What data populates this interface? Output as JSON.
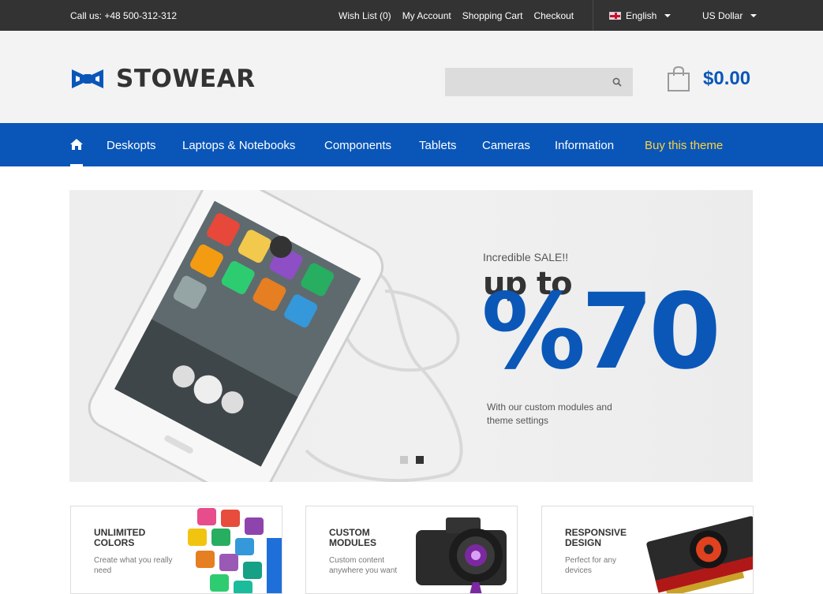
{
  "topbar": {
    "phone": "Call us: +48 500-312-312",
    "links": [
      "Wish List (0)",
      "My Account",
      "Shopping Cart",
      "Checkout"
    ],
    "language": "English",
    "currency": "US Dollar"
  },
  "header": {
    "logo_text": "STOWEAR",
    "search_placeholder": "",
    "cart_total": "$0.00"
  },
  "nav": {
    "items": [
      "Deskopts",
      "Laptops & Notebooks",
      "Components",
      "Tablets",
      "Cameras",
      "Information"
    ],
    "highlight": "Buy this theme"
  },
  "slider": {
    "kicker": "Incredible SALE!!",
    "headline": "up to",
    "big": "%70",
    "description": "With our custom modules and theme settings",
    "slides": 2,
    "active_slide": 2
  },
  "features": [
    {
      "title": "UNLIMITED COLORS",
      "subtitle": "Create what you really need"
    },
    {
      "title": "CUSTOM MODULES",
      "subtitle": "Custom content anywhere you want"
    },
    {
      "title": "RESPONSIVE DESIGN",
      "subtitle": "Perfect for any devices"
    }
  ],
  "colors": {
    "brand_blue": "#0a56b8",
    "accent_yellow": "#ffd33d",
    "topbar": "#333333"
  }
}
